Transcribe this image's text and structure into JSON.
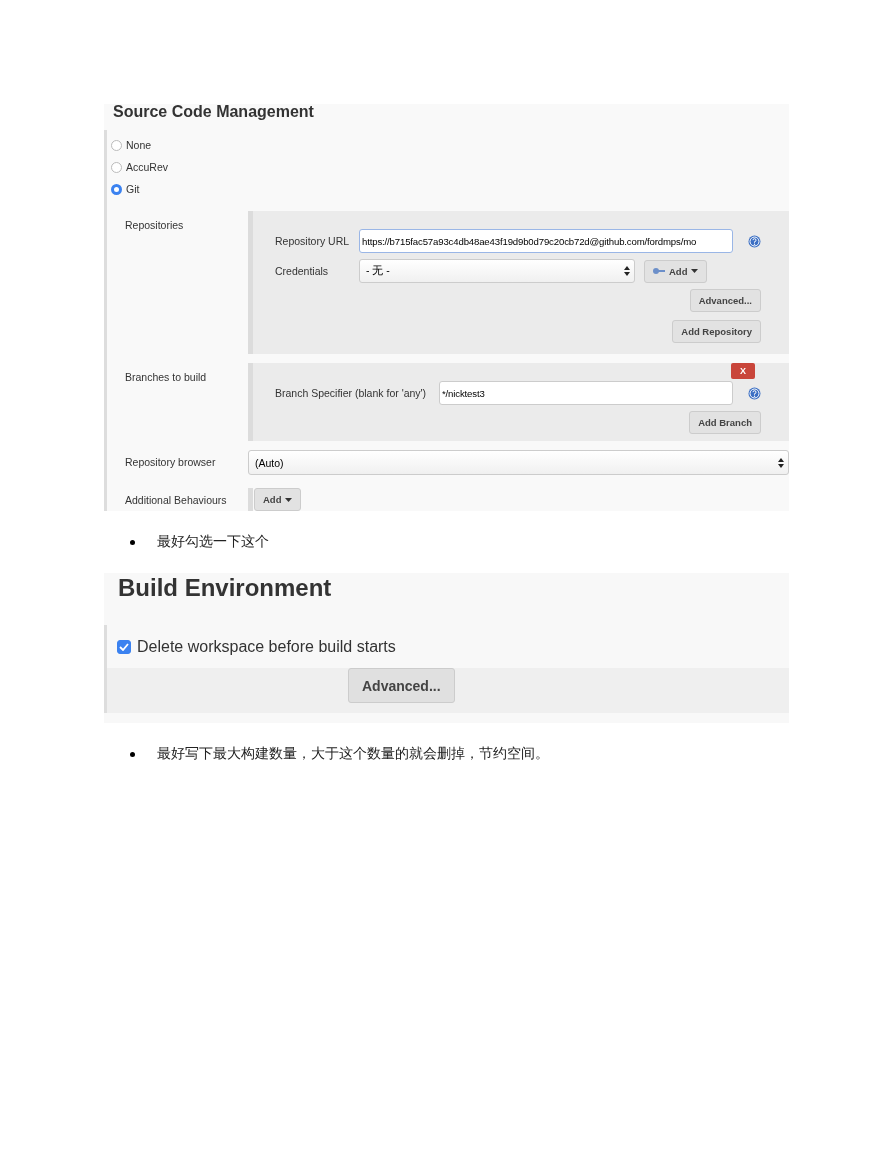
{
  "scm": {
    "title": "Source Code Management",
    "options": [
      {
        "label": "None",
        "selected": false
      },
      {
        "label": "AccuRev",
        "selected": false
      },
      {
        "label": "Git",
        "selected": true
      }
    ],
    "repositories": {
      "label": "Repositories",
      "url_label": "Repository URL",
      "url_value": "https://b715fac57a93c4db48ae43f19d9b0d79c20cb72d@github.com/fordmps/mo",
      "credentials_label": "Credentials",
      "credentials_value": "- 无 -",
      "add_button": "Add",
      "advanced_button": "Advanced...",
      "add_repository_button": "Add Repository"
    },
    "branches": {
      "label": "Branches to build",
      "remove_button": "X",
      "specifier_label": "Branch Specifier (blank for 'any')",
      "specifier_value": "*/nicktest3",
      "add_branch_button": "Add Branch"
    },
    "browser": {
      "label": "Repository browser",
      "value": "(Auto)"
    },
    "behaviours": {
      "label": "Additional Behaviours",
      "add_button": "Add"
    }
  },
  "note_1": "最好勾选一下这个",
  "build_environment": {
    "title": "Build Environment",
    "option": {
      "label": "Delete workspace before build starts",
      "checked": true
    },
    "advanced_button": "Advanced..."
  },
  "note_2": "最好写下最大构建数量，大于这个数量的就会删掉，节约空间。"
}
